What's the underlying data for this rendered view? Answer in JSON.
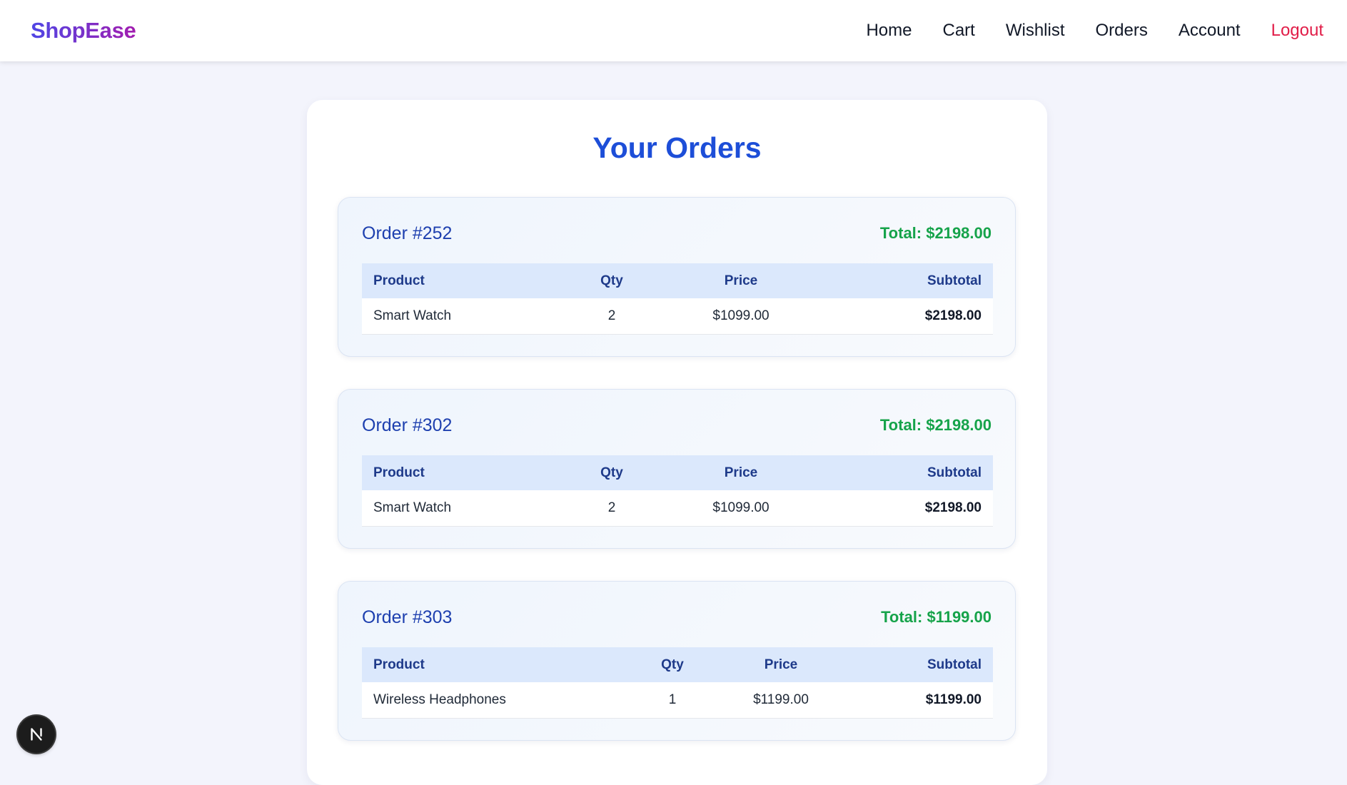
{
  "nav": {
    "brand": "ShopEase",
    "links": [
      "Home",
      "Cart",
      "Wishlist",
      "Orders",
      "Account"
    ],
    "logout": "Logout"
  },
  "page": {
    "title": "Your Orders"
  },
  "orders": [
    {
      "label": "Order #252",
      "total": "Total: $2198.00",
      "headers": [
        "Product",
        "Qty",
        "Price",
        "Subtotal"
      ],
      "items": [
        {
          "product": "Smart Watch",
          "qty": "2",
          "price": "$1099.00",
          "subtotal": "$2198.00"
        }
      ]
    },
    {
      "label": "Order #302",
      "total": "Total: $2198.00",
      "headers": [
        "Product",
        "Qty",
        "Price",
        "Subtotal"
      ],
      "items": [
        {
          "product": "Smart Watch",
          "qty": "2",
          "price": "$1099.00",
          "subtotal": "$2198.00"
        }
      ]
    },
    {
      "label": "Order #303",
      "total": "Total: $1199.00",
      "headers": [
        "Product",
        "Qty",
        "Price",
        "Subtotal"
      ],
      "items": [
        {
          "product": "Wireless Headphones",
          "qty": "1",
          "price": "$1199.00",
          "subtotal": "$1199.00"
        }
      ]
    }
  ],
  "colors": {
    "brand_gradient": [
      "#4f46e5",
      "#a21caf"
    ],
    "title": "#1d4ed8",
    "total": "#16a34a",
    "logout": "#e11d48",
    "table_header_bg": "#dbe8fc"
  },
  "icons": {
    "dev_badge": "nextjs-icon"
  }
}
